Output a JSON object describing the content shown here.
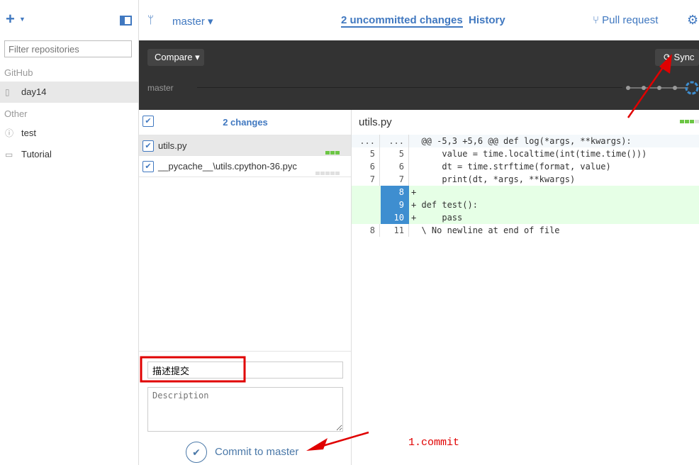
{
  "sidebar": {
    "add_label": "+",
    "filter_placeholder": "Filter repositories",
    "sections": [
      {
        "title": "GitHub",
        "repos": [
          {
            "name": "day14",
            "icon": "repo-icon",
            "selected": true
          }
        ]
      },
      {
        "title": "Other",
        "repos": [
          {
            "name": "test",
            "icon": "alert-icon"
          },
          {
            "name": "Tutorial",
            "icon": "monitor-icon"
          }
        ]
      }
    ]
  },
  "header": {
    "branch": "master",
    "tabs": [
      {
        "label": "2 uncommitted changes",
        "active": true
      },
      {
        "label": "History"
      }
    ],
    "pull_request": "Pull request"
  },
  "toolbar": {
    "compare": "Compare",
    "sync": "Sync",
    "branch_line_label": "master"
  },
  "changes": {
    "title": "2 changes",
    "files": [
      {
        "name": "utils.py",
        "checked": true
      },
      {
        "name": "__pycache__\\utils.cpython-36.pyc",
        "checked": true
      }
    ]
  },
  "diff": {
    "file": "utils.py",
    "rows": [
      {
        "a": "...",
        "b": "...",
        "code": "  @@ -5,3 +5,6 @@ def log(*args, **kwargs):",
        "type": "hunk"
      },
      {
        "a": "5",
        "b": "5",
        "code": "      value = time.localtime(int(time.time()))",
        "type": "ctx"
      },
      {
        "a": "6",
        "b": "6",
        "code": "      dt = time.strftime(format, value)",
        "type": "ctx"
      },
      {
        "a": "7",
        "b": "7",
        "code": "      print(dt, *args, **kwargs)",
        "type": "ctx"
      },
      {
        "a": "",
        "b": "8",
        "code": "+",
        "type": "add"
      },
      {
        "a": "",
        "b": "9",
        "code": "+ def test():",
        "type": "add"
      },
      {
        "a": "",
        "b": "10",
        "code": "+     pass",
        "type": "add"
      },
      {
        "a": "8",
        "b": "11",
        "code": "  \\ No newline at end of file",
        "type": "ctx"
      }
    ]
  },
  "commit": {
    "summary": "描述提交",
    "description_placeholder": "Description",
    "button": "Commit to master"
  },
  "annotation": {
    "text": "1.commit",
    "color": "#e00000"
  }
}
